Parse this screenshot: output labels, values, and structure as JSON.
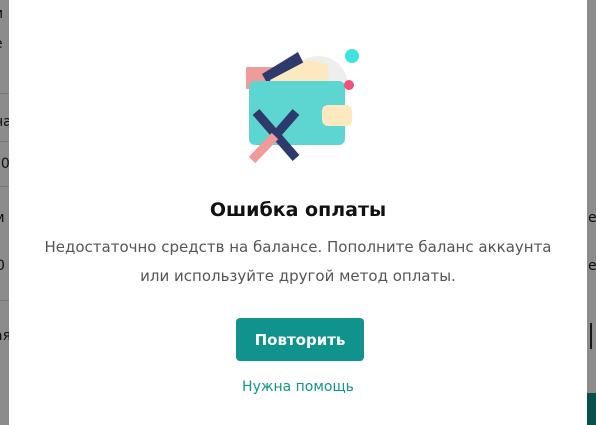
{
  "background": {
    "left_fragments": [
      "и",
      "е",
      "на",
      "00",
      "м",
      "0",
      "ая"
    ],
    "right_fragments": [
      "е",
      "е"
    ]
  },
  "modal": {
    "illustration": {
      "icon": "wallet-error-icon"
    },
    "title": "Ошибка оплаты",
    "message": "Недостаточно средств на балансе. Пополните баланс аккаунта или используйте другой метод оплаты.",
    "retry_label": "Повторить",
    "help_label": "Нужна помощь"
  },
  "colors": {
    "accent": "#0f938c",
    "wallet": "#5dd6d1",
    "cross_dark": "#2d3a6b",
    "cross_light": "#f19a9a",
    "dot_cyan": "#3de3e0",
    "dot_pink": "#f0507a"
  }
}
